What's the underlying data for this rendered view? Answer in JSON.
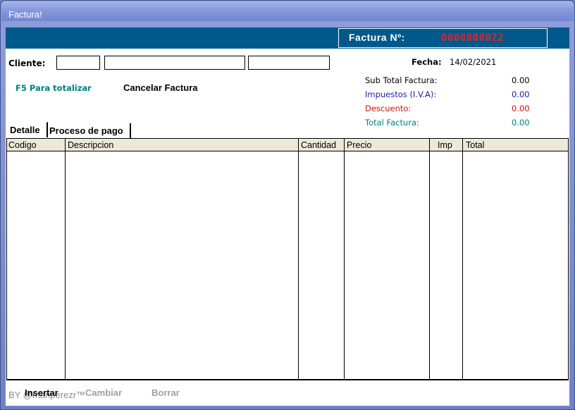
{
  "window": {
    "title": "Factura!"
  },
  "banner": {
    "label": "Factura Nº:",
    "number": "0000000022"
  },
  "cliente": {
    "label": "Cliente:",
    "code": "",
    "name": "",
    "extra": ""
  },
  "fecha": {
    "label": "Fecha:",
    "value": "14/02/2021"
  },
  "actions": {
    "totalizar": "F5 Para totalizar",
    "cancelar": "Cancelar Factura"
  },
  "totals": {
    "subtotal": {
      "label": "Sub Total Factura:",
      "value": "0.00"
    },
    "impuestos": {
      "label": "Impuestos (I.V.A):",
      "value": "0.00"
    },
    "descuento": {
      "label": "Descuento:",
      "value": "0.00"
    },
    "total": {
      "label": "Total Factura:",
      "value": "0.00"
    }
  },
  "tabs": [
    "Detalle",
    "Proceso de pago"
  ],
  "grid": {
    "columns": [
      "Codigo",
      "Descripcion",
      "Cantidad",
      "Precio",
      "Imp",
      "Total"
    ],
    "rows": []
  },
  "buttons": {
    "insertar": "Insertar",
    "cambiar": "Cambiar",
    "borrar": "Borrar"
  },
  "watermark": "BY @manperezr™",
  "colors": {
    "banner": "#00598a",
    "number": "#e4202a",
    "teal": "#008080",
    "blue": "#1c1ca8",
    "red": "#d01010"
  }
}
